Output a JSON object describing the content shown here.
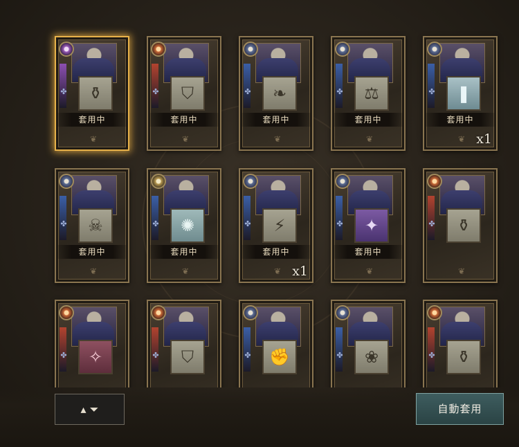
{
  "cards": [
    {
      "emblem": "violet",
      "strip": "#8c4fb0",
      "skill_icon": "⚱",
      "skill_variant": "",
      "status": "套用中",
      "count": "",
      "selected": true
    },
    {
      "emblem": "fire",
      "strip": "#b2432f",
      "skill_icon": "⛉",
      "skill_variant": "",
      "status": "套用中",
      "count": "",
      "selected": false
    },
    {
      "emblem": "",
      "strip": "#3b5fa6",
      "skill_icon": "❧",
      "skill_variant": "",
      "status": "套用中",
      "count": "",
      "selected": false
    },
    {
      "emblem": "",
      "strip": "#3b5fa6",
      "skill_icon": "⚖",
      "skill_variant": "",
      "status": "套用中",
      "count": "",
      "selected": false
    },
    {
      "emblem": "",
      "strip": "#3b5fa6",
      "skill_icon": "❚",
      "skill_variant": "iceblue",
      "status": "套用中",
      "count": "x1",
      "selected": false
    },
    {
      "emblem": "",
      "strip": "#3b5fa6",
      "skill_icon": "☠",
      "skill_variant": "",
      "status": "套用中",
      "count": "",
      "selected": false
    },
    {
      "emblem": "sun",
      "strip": "#3b5fa6",
      "skill_icon": "✺",
      "skill_variant": "teal",
      "status": "套用中",
      "count": "",
      "selected": false
    },
    {
      "emblem": "",
      "strip": "#3b5fa6",
      "skill_icon": "⚡",
      "skill_variant": "",
      "status": "套用中",
      "count": "x1",
      "selected": false
    },
    {
      "emblem": "",
      "strip": "#3b5fa6",
      "skill_icon": "✦",
      "skill_variant": "purple",
      "status": "套用中",
      "count": "",
      "selected": false
    },
    {
      "emblem": "fire",
      "strip": "#b2432f",
      "skill_icon": "⚱",
      "skill_variant": "",
      "status": "",
      "count": "",
      "selected": false
    },
    {
      "emblem": "fire",
      "strip": "#b2432f",
      "skill_icon": "✧",
      "skill_variant": "pink",
      "status": "",
      "count": "",
      "selected": false
    },
    {
      "emblem": "fire",
      "strip": "#b2432f",
      "skill_icon": "⛉",
      "skill_variant": "",
      "status": "",
      "count": "",
      "selected": false
    },
    {
      "emblem": "",
      "strip": "#3b5fa6",
      "skill_icon": "✊",
      "skill_variant": "",
      "status": "",
      "count": "",
      "selected": false
    },
    {
      "emblem": "",
      "strip": "#3b5fa6",
      "skill_icon": "❀",
      "skill_variant": "",
      "status": "",
      "count": "",
      "selected": false
    },
    {
      "emblem": "fire",
      "strip": "#b2432f",
      "skill_icon": "⚱",
      "skill_variant": "",
      "status": "",
      "count": "",
      "selected": false
    }
  ],
  "filter_button": {
    "icon": "funnel-sort-icon",
    "glyph": "▴ ⏷"
  },
  "auto_apply_button": {
    "label": "自動套用"
  }
}
